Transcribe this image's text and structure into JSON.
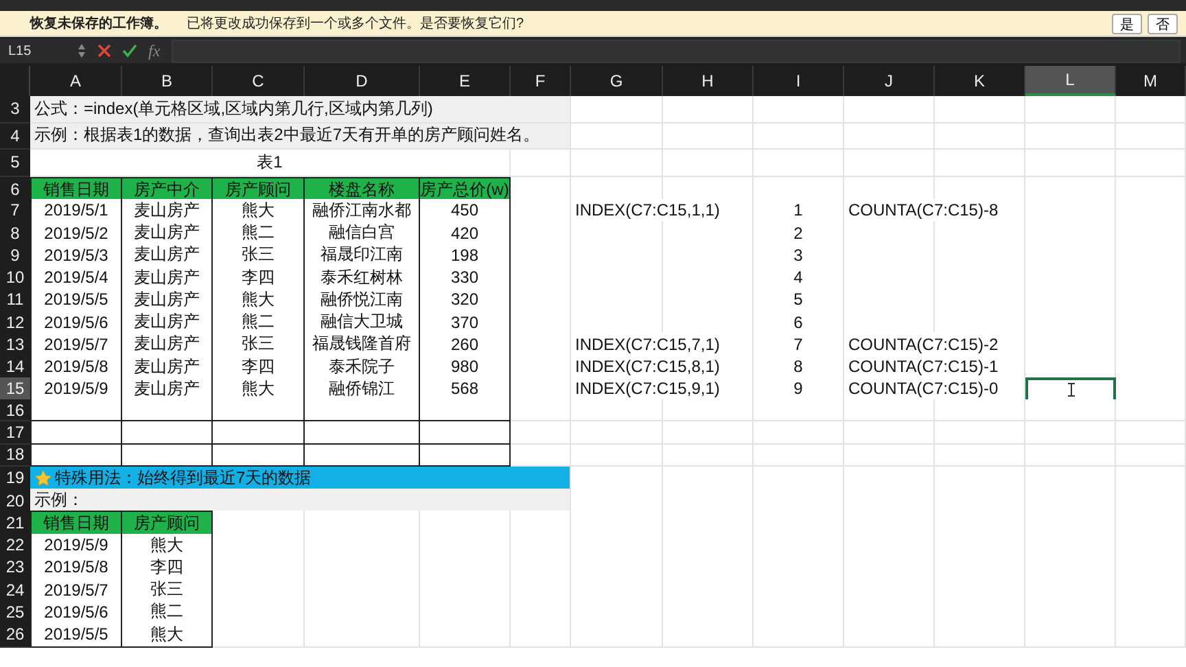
{
  "recovery_bar": {
    "title": "恢复未保存的工作簿。",
    "message": "已将更改成功保存到一个或多个文件。是否要恢复它们?",
    "buttons": [
      "是",
      "否"
    ]
  },
  "formula_bar": {
    "name_box": "L15",
    "function_label": "fx"
  },
  "columns": [
    {
      "label": "A",
      "selected": false
    },
    {
      "label": "B",
      "selected": false
    },
    {
      "label": "C",
      "selected": false
    },
    {
      "label": "D",
      "selected": false
    },
    {
      "label": "E",
      "selected": false
    },
    {
      "label": "F",
      "selected": false
    },
    {
      "label": "G",
      "selected": false
    },
    {
      "label": "H",
      "selected": false
    },
    {
      "label": "I",
      "selected": false
    },
    {
      "label": "J",
      "selected": false
    },
    {
      "label": "K",
      "selected": false
    },
    {
      "label": "L",
      "selected": true
    },
    {
      "label": "M",
      "selected": false
    }
  ],
  "rows": [
    {
      "number": "3",
      "selected": false,
      "kind": "note",
      "text": "公式：=index(单元格区域,区域内第几行,区域内第几列)"
    },
    {
      "number": "4",
      "selected": false,
      "kind": "note",
      "text": "示例：根据表1的数据，查询出表2中最近7天有开单的房产顾问姓名。"
    },
    {
      "number": "5",
      "selected": false,
      "kind": "caption",
      "text": "表1"
    },
    {
      "number": "6",
      "selected": false,
      "kind": "header",
      "table_cells": [
        "销售日期",
        "房产中介",
        "房产顾问",
        "楼盘名称",
        "房产总价(w)"
      ]
    },
    {
      "number": "7",
      "selected": false,
      "kind": "data",
      "table_cells": [
        "2019/5/1",
        "麦山房产",
        "熊大",
        "融侨江南水都",
        "450"
      ],
      "other_cells": [
        null,
        "INDEX(C7:C15,1,1)",
        null,
        "1",
        "COUNTA(C7:C15)-8"
      ]
    },
    {
      "number": "8",
      "selected": false,
      "kind": "data",
      "table_cells": [
        "2019/5/2",
        "麦山房产",
        "熊二",
        "融信白宫",
        "420"
      ],
      "other_cells": [
        null,
        null,
        null,
        "2"
      ]
    },
    {
      "number": "9",
      "selected": false,
      "kind": "data",
      "table_cells": [
        "2019/5/3",
        "麦山房产",
        "张三",
        "福晟印江南",
        "198"
      ],
      "other_cells": [
        null,
        null,
        null,
        "3"
      ]
    },
    {
      "number": "10",
      "selected": false,
      "kind": "data",
      "table_cells": [
        "2019/5/4",
        "麦山房产",
        "李四",
        "泰禾红树林",
        "330"
      ],
      "other_cells": [
        null,
        null,
        null,
        "4"
      ]
    },
    {
      "number": "11",
      "selected": false,
      "kind": "data",
      "table_cells": [
        "2019/5/5",
        "麦山房产",
        "熊大",
        "融侨悦江南",
        "320"
      ],
      "other_cells": [
        null,
        null,
        null,
        "5"
      ]
    },
    {
      "number": "12",
      "selected": false,
      "kind": "data",
      "table_cells": [
        "2019/5/6",
        "麦山房产",
        "熊二",
        "融信大卫城",
        "370"
      ],
      "other_cells": [
        null,
        null,
        null,
        "6"
      ]
    },
    {
      "number": "13",
      "selected": false,
      "kind": "data",
      "table_cells": [
        "2019/5/7",
        "麦山房产",
        "张三",
        "福晟钱隆首府",
        "260"
      ],
      "other_cells": [
        null,
        "INDEX(C7:C15,7,1)",
        null,
        "7",
        "COUNTA(C7:C15)-2"
      ]
    },
    {
      "number": "14",
      "selected": false,
      "kind": "data",
      "table_cells": [
        "2019/5/8",
        "麦山房产",
        "李四",
        "泰禾院子",
        "980"
      ],
      "other_cells": [
        null,
        "INDEX(C7:C15,8,1)",
        null,
        "8",
        "COUNTA(C7:C15)-1"
      ]
    },
    {
      "number": "15",
      "selected": true,
      "kind": "data",
      "table_cells": [
        "2019/5/9",
        "麦山房产",
        "熊大",
        "融侨锦江",
        "568"
      ],
      "other_cells": [
        null,
        "INDEX(C7:C15,9,1)",
        null,
        "9",
        "COUNTA(C7:C15)-0"
      ]
    },
    {
      "number": "16",
      "selected": false,
      "kind": "data",
      "table_cells": [
        null,
        null,
        null,
        null,
        null
      ]
    },
    {
      "number": "17",
      "selected": false,
      "kind": "data",
      "table_cells": [
        null,
        null,
        null,
        null,
        null
      ]
    },
    {
      "number": "18",
      "selected": false,
      "kind": "data",
      "table_cells": [
        null,
        null,
        null,
        null,
        null
      ]
    },
    {
      "number": "19",
      "selected": false,
      "kind": "banner",
      "text": "特殊用法：始终得到最近7天的数据"
    },
    {
      "number": "20",
      "selected": false,
      "kind": "note",
      "text": "示例："
    },
    {
      "number": "21",
      "selected": false,
      "kind": "header",
      "table_cells": [
        "销售日期",
        "房产顾问"
      ]
    },
    {
      "number": "22",
      "selected": false,
      "kind": "data",
      "table_cells": [
        "2019/5/9",
        "熊大"
      ]
    },
    {
      "number": "23",
      "selected": false,
      "kind": "data",
      "table_cells": [
        "2019/5/8",
        "李四"
      ]
    },
    {
      "number": "24",
      "selected": false,
      "kind": "data",
      "table_cells": [
        "2019/5/7",
        "张三"
      ]
    },
    {
      "number": "25",
      "selected": false,
      "kind": "data",
      "table_cells": [
        "2019/5/6",
        "熊二"
      ]
    },
    {
      "number": "26",
      "selected": false,
      "kind": "data",
      "table_cells": [
        "2019/5/5",
        "熊大"
      ]
    }
  ]
}
